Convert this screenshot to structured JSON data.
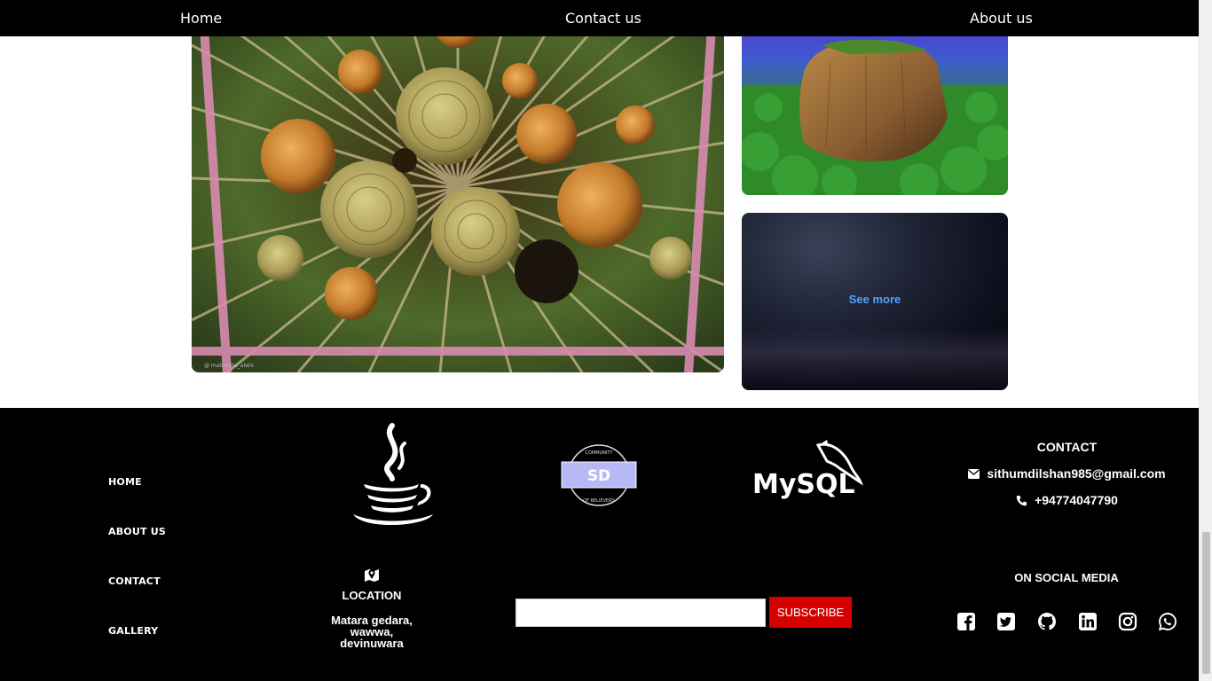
{
  "nav": {
    "home": "Home",
    "contact": "Contact us",
    "about": "About us"
  },
  "gallery": {
    "see_more": "See more",
    "watermark": "@ mateesha_alwis"
  },
  "footer": {
    "links": [
      "HOME",
      "ABOUT US",
      "CONTACT",
      "GALLERY"
    ],
    "logos": {
      "sd_top": "COMMUNITY",
      "sd_text": "SD",
      "sd_bottom": "OF BELIEVERS",
      "mysql": "MySQL"
    },
    "contact": {
      "title": "CONTACT",
      "email": "sithumdilshan985@gmail.com",
      "phone": "+94774047790"
    },
    "location": {
      "title": "LOCATION",
      "address_line1": "Matara gedara,",
      "address_line2": "wawwa,",
      "address_line3": "devinuwara"
    },
    "subscribe": {
      "button": "SUBSCRIBE",
      "placeholder": ""
    },
    "social": {
      "title": "ON SOCIAL MEDIA",
      "icons": [
        "facebook-icon",
        "twitter-icon",
        "github-icon",
        "linkedin-icon",
        "instagram-icon",
        "whatsapp-icon"
      ]
    }
  },
  "colors": {
    "accent_link": "#4ea1ff",
    "subscribe_button": "#d60000",
    "background_dark": "#000000"
  }
}
